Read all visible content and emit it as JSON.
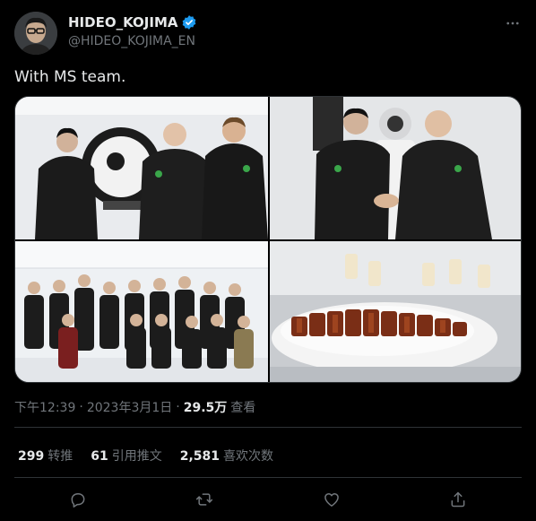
{
  "author": {
    "display_name": "HIDEO_KOJIMA",
    "handle": "@HIDEO_KOJIMA_EN",
    "verified": true,
    "verified_color": "#1d9bf0"
  },
  "tweet": {
    "text": "With MS team."
  },
  "media": [
    {
      "name": "photo-kojima-productions-sign"
    },
    {
      "name": "photo-handshake"
    },
    {
      "name": "photo-group"
    },
    {
      "name": "photo-buffet-food"
    }
  ],
  "meta": {
    "time": "下午12:39",
    "separator": "·",
    "date": "2023年3月1日",
    "views_count": "29.5万",
    "views_label": "查看"
  },
  "stats": {
    "retweets_count": "299",
    "retweets_label": "转推",
    "quotes_count": "61",
    "quotes_label": "引用推文",
    "likes_count": "2,581",
    "likes_label": "喜欢次数"
  },
  "icons": {
    "more": "more-icon",
    "reply": "reply-icon",
    "retweet": "retweet-icon",
    "like": "like-icon",
    "share": "share-icon"
  },
  "colors": {
    "background": "#000000",
    "text_primary": "#e7e9ea",
    "text_secondary": "#71767b",
    "divider": "#2f3336",
    "accent": "#1d9bf0"
  }
}
